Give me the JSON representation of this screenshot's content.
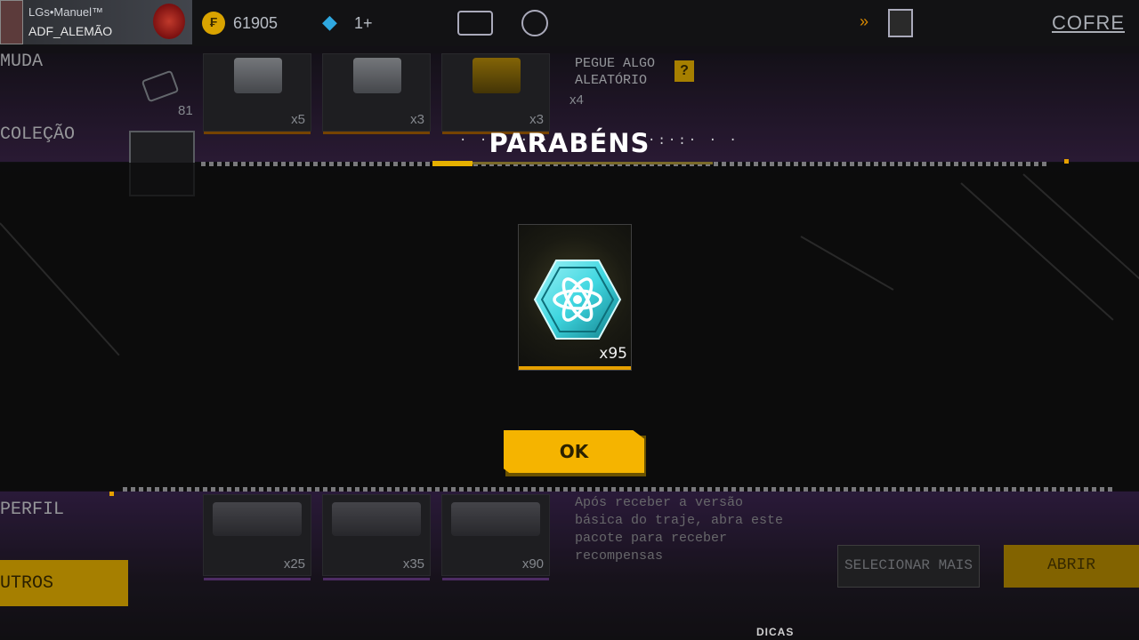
{
  "topbar": {
    "player_name": "LGs•Manuel™",
    "player_clan": "ADF_ALEMÃO",
    "coins": "61905",
    "diamonds": "1+",
    "vault_label": "COFRE",
    "icons": [
      "rank-icon",
      "coin-icon",
      "diamond-icon",
      "card-icon",
      "cloud-icon",
      "forward-icon",
      "profile-icon"
    ]
  },
  "sidebar": {
    "top_label": "MUDA",
    "collection_label": "COLEÇÃO",
    "profile_label": "PERFIL",
    "others_label": "UTROS",
    "ticket_count": "81"
  },
  "items_top": [
    {
      "count": "x5"
    },
    {
      "count": "x3"
    },
    {
      "count": "x3"
    }
  ],
  "random_item": {
    "text_line1": "PEGUE ALGO",
    "text_line2": "ALEATÓRIO",
    "help": "?",
    "count": "x4"
  },
  "items_bottom": [
    {
      "count": "x25"
    },
    {
      "count": "x35"
    },
    {
      "count": "x90"
    }
  ],
  "description": "Após receber a versão básica do traje, abra este pacote para receber recompensas",
  "actions": {
    "select_more": "SELECIONAR MAIS",
    "open": "ABRIR"
  },
  "modal": {
    "title": "PARABÉNS",
    "reward": {
      "icon": "atom-hexagon-icon",
      "quantity": "x95"
    },
    "ok_label": "OK"
  },
  "watermark": "DICAS",
  "colors": {
    "accent_yellow": "#f5b400",
    "purple": "#3b2450",
    "background": "#141414",
    "reward_cyan": "#3fd6e0"
  }
}
